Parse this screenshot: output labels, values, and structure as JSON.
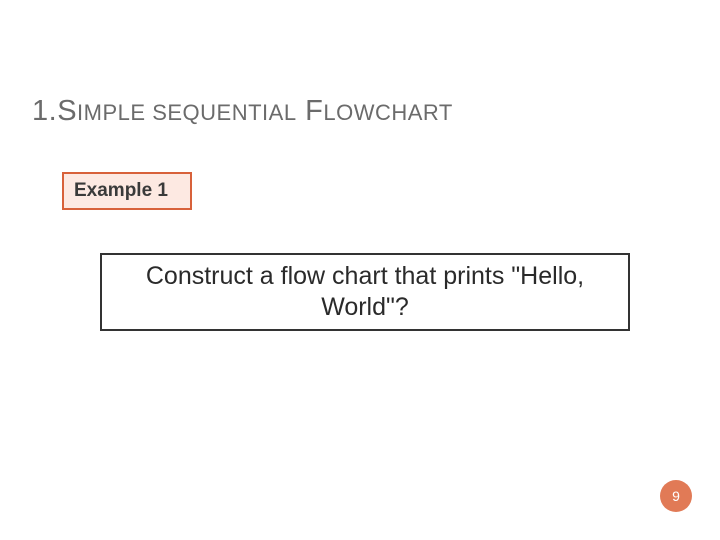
{
  "heading": {
    "num": "1.",
    "t1_big": "S",
    "t1_small": "IMPLE",
    "space": " ",
    "t2_small": "SEQUENTIAL",
    "t3_big": " F",
    "t3_small": "LOWCHART"
  },
  "example_label": "Example 1",
  "question_text": "Construct a flow chart that prints \"Hello, World\"?",
  "page_number": "9"
}
